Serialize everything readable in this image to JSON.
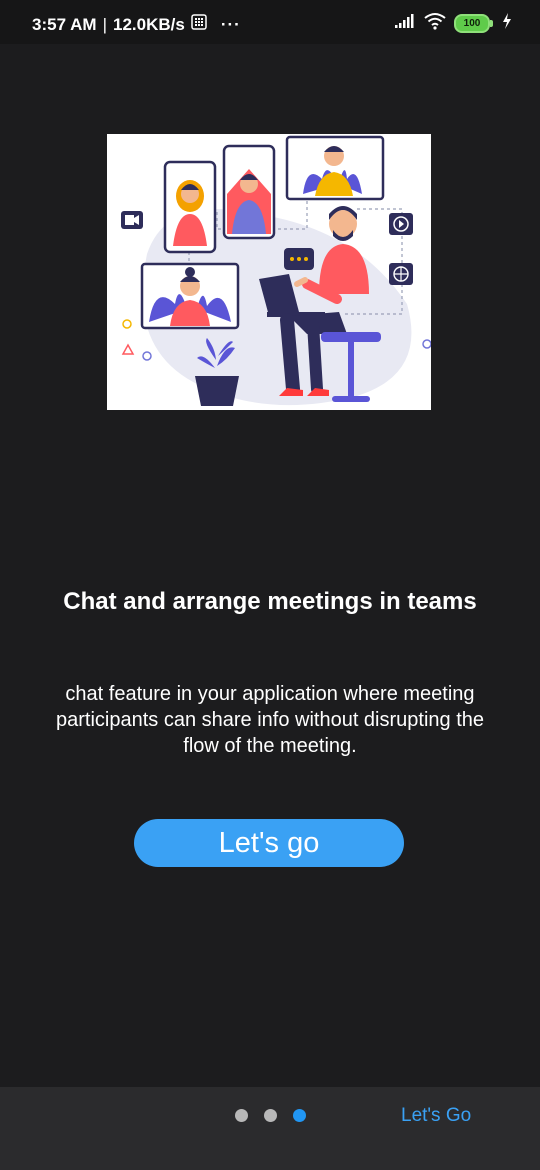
{
  "status_bar": {
    "time": "3:57 AM",
    "separator": "|",
    "network_speed": "12.0KB/s",
    "more_indicator": "···",
    "battery_level": "100",
    "icons": [
      "sim-icon",
      "signal-icon",
      "wifi-icon",
      "battery-icon",
      "charging-icon"
    ]
  },
  "hero": {
    "illustration": "video-meeting-illustration"
  },
  "content": {
    "title": "Chat and arrange meetings in teams",
    "description": "chat feature in your application where meeting participants can share info without disrupting the flow of the meeting."
  },
  "cta": {
    "label": "Let's go"
  },
  "pager": {
    "pages": 3,
    "active_index": 2,
    "next_label": "Let's Go"
  },
  "colors": {
    "background": "#1c1c1e",
    "accent": "#3aa1f4",
    "active_dot": "#2196f3",
    "inactive_dot": "#b8b8b8",
    "bottom_bar": "#2b2b2d"
  }
}
